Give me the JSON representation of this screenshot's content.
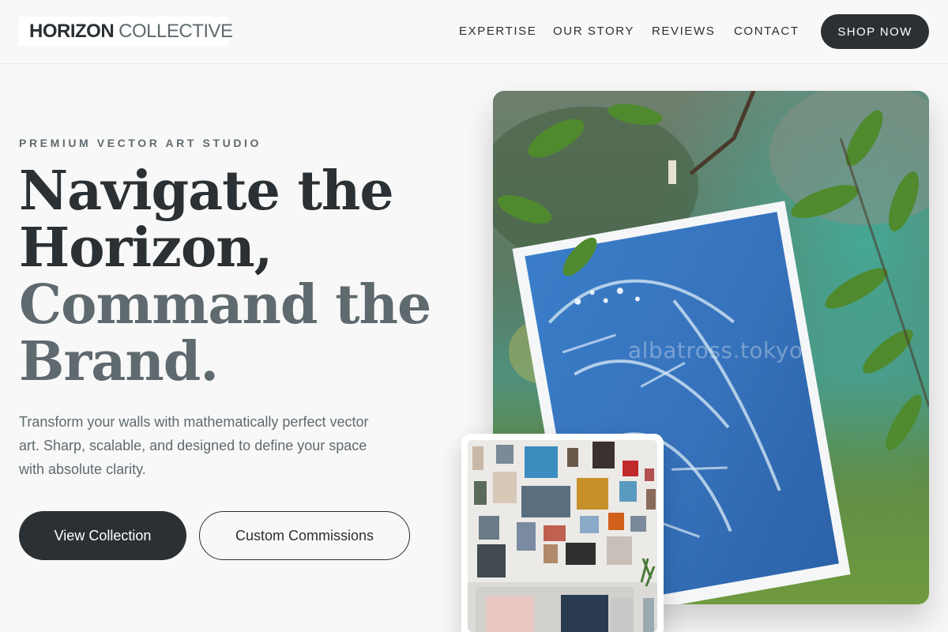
{
  "header": {
    "logo": {
      "strong": "HORIZON",
      "light": "COLLECTIVE"
    },
    "nav": [
      "EXPERTISE",
      "OUR STORY",
      "REVIEWS",
      "CONTACT"
    ],
    "cta": "SHOP NOW"
  },
  "hero": {
    "eyebrow": "PREMIUM VECTOR ART STUDIO",
    "headline": [
      "Navigate the",
      "Horizon,",
      "Command the",
      "Brand."
    ],
    "description": "Transform your walls with mathematically perfect vector art. Sharp, scalable, and designed to define your space with absolute clarity.",
    "primary_button": "View Collection",
    "secondary_button": "Custom Commissions",
    "main_image": {
      "icon": "cyanotype-print-photo",
      "watermark": "albatross.tokyo"
    },
    "inset_image": {
      "icon": "gallery-wall-photo"
    }
  },
  "colors": {
    "dark": "#2a3033",
    "muted": "#5f6a6f",
    "background": "#f8f8f8",
    "accent_blue": "#3b78c4"
  }
}
